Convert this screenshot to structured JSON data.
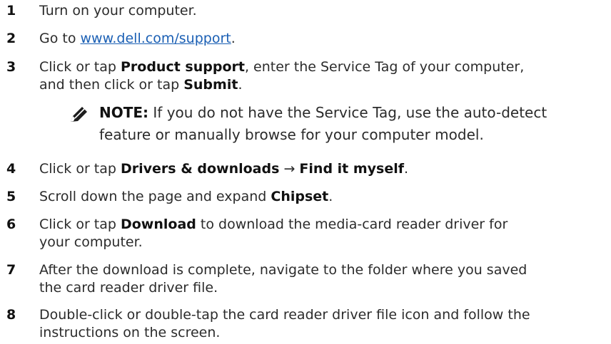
{
  "steps": [
    {
      "num": "1",
      "text": "Turn on your computer."
    },
    {
      "num": "2",
      "prefix": "Go to ",
      "link": "www.dell.com/support",
      "suffix": "."
    },
    {
      "num": "3",
      "t1": "Click or tap ",
      "b1": "Product support",
      "t2": ", enter the Service Tag of your computer,",
      "t3": "and then click or tap ",
      "b2": "Submit",
      "t4": "."
    },
    {
      "num": "4",
      "t1": "Click or tap ",
      "b1": "Drivers & downloads",
      "t2": " → ",
      "b2": "Find it myself",
      "t3": "."
    },
    {
      "num": "5",
      "t1": "Scroll down the page and expand ",
      "b1": "Chipset",
      "t2": "."
    },
    {
      "num": "6",
      "t1": "Click or tap ",
      "b1": "Download",
      "t2": " to download the media-card reader driver for",
      "t3": "your computer."
    },
    {
      "num": "7",
      "line1": "After the download is complete, navigate to the folder where you saved",
      "line2": "the card reader driver file."
    },
    {
      "num": "8",
      "line1": "Double-click or double-tap the card reader driver file icon and follow the",
      "line2": "instructions on the screen."
    }
  ],
  "note": {
    "label": "NOTE:",
    "line1": " If you do not have the Service Tag, use the auto-detect",
    "line2": "feature or manually browse for your computer model.",
    "icon": "note-pencil-icon"
  }
}
